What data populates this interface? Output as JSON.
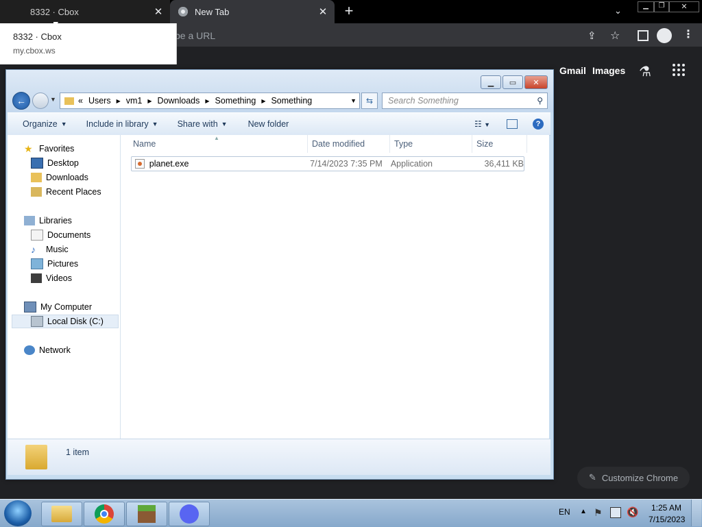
{
  "browser": {
    "tabs": [
      {
        "title": "8332 · Cbox"
      },
      {
        "title": "New Tab"
      }
    ],
    "new_tab_symbol": "+",
    "omnibox_placeholder": "ype a URL",
    "tooltip": {
      "title": "8332 · Cbox",
      "url": "my.cbox.ws"
    },
    "ntp": {
      "gmail": "Gmail",
      "images": "Images",
      "customize": "Customize Chrome"
    }
  },
  "explorer": {
    "breadcrumb": [
      "«",
      "Users",
      "vm1",
      "Downloads",
      "Something",
      "Something"
    ],
    "search_placeholder": "Search Something",
    "toolbar": {
      "organize": "Organize",
      "include": "Include in library",
      "share": "Share with",
      "new_folder": "New folder"
    },
    "nav": {
      "favorites": "Favorites",
      "desktop": "Desktop",
      "downloads": "Downloads",
      "recent": "Recent Places",
      "libraries": "Libraries",
      "documents": "Documents",
      "music": "Music",
      "pictures": "Pictures",
      "videos": "Videos",
      "computer": "My Computer",
      "local_disk": "Local Disk (C:)",
      "network": "Network"
    },
    "columns": {
      "name": "Name",
      "date": "Date modified",
      "type": "Type",
      "size": "Size"
    },
    "files": [
      {
        "name": "planet.exe",
        "date": "7/14/2023 7:35 PM",
        "type": "Application",
        "size": "36,411 KB"
      }
    ],
    "status": "1 item"
  },
  "taskbar": {
    "lang": "EN",
    "time": "1:25 AM",
    "date": "7/15/2023"
  },
  "colors": {
    "chrome_dark": "#202124",
    "explorer_blue": "#c7ddf0",
    "taskbar": "#9dbbdb"
  }
}
